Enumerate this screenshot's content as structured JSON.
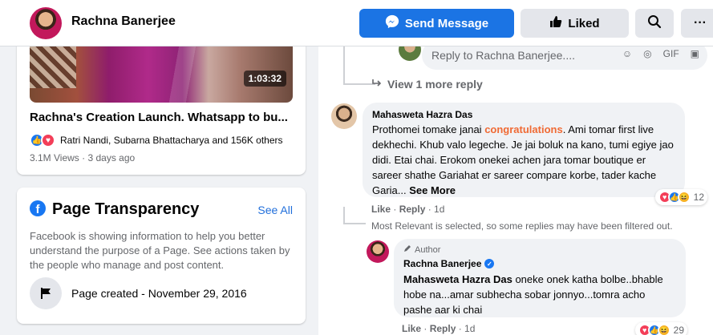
{
  "header": {
    "name": "Rachna Banerjee",
    "send_message_label": "Send Message",
    "liked_label": "Liked",
    "more_label": "···"
  },
  "video": {
    "duration": "1:03:32",
    "title": "Rachna's Creation Launch. Whatsapp to bu...",
    "reaction_names": "Ratri Nandi, Subarna Bhattacharya and 156K others",
    "meta": "3.1M Views · 3 days ago"
  },
  "transparency": {
    "title": "Page Transparency",
    "see_all": "See All",
    "description": "Facebook is showing information to help you better understand the purpose of a Page. See actions taken by the people who manage and post content.",
    "page_created": "Page created - November 29, 2016"
  },
  "comments": {
    "reply_placeholder": "Reply to Rachna Banerjee....",
    "reply_icons": [
      "☺",
      "◎",
      "GIF",
      "▣"
    ],
    "view_more": "View 1 more reply",
    "main": {
      "author": "Mahasweta Hazra Das",
      "text_before": "Prothomei tomake janai ",
      "highlight": "congratulations",
      "text_after": ". Ami tomar first live dekhechi. Khub valo legeche. Je jai boluk na kano, tumi egiye jao didi. Etai chai. Erokom onekei achen jara tomar boutique er sareer shathe Gariahat er sareer compare korbe, tader kache Garia...",
      "see_more": " See More",
      "reaction_count": "12",
      "like": "Like",
      "reply": "Reply",
      "time": "1d"
    },
    "filter_note": "Most Relevant is selected, so some replies may have been filtered out.",
    "reply": {
      "badge": "Author",
      "author": "Rachna Banerjee",
      "mention": "Mahasweta Hazra Das",
      "text": " oneke onek katha bolbe..bhable hobe na...amar subhecha sobar jonnyo...tomra acho pashe aar ki chai",
      "reaction_count": "29",
      "like": "Like",
      "reply": "Reply",
      "time": "1d"
    }
  },
  "colors": {
    "primary": "#1b74e4",
    "background": "#f0f2f5",
    "highlight": "#f06a34",
    "muted": "#65676b"
  }
}
